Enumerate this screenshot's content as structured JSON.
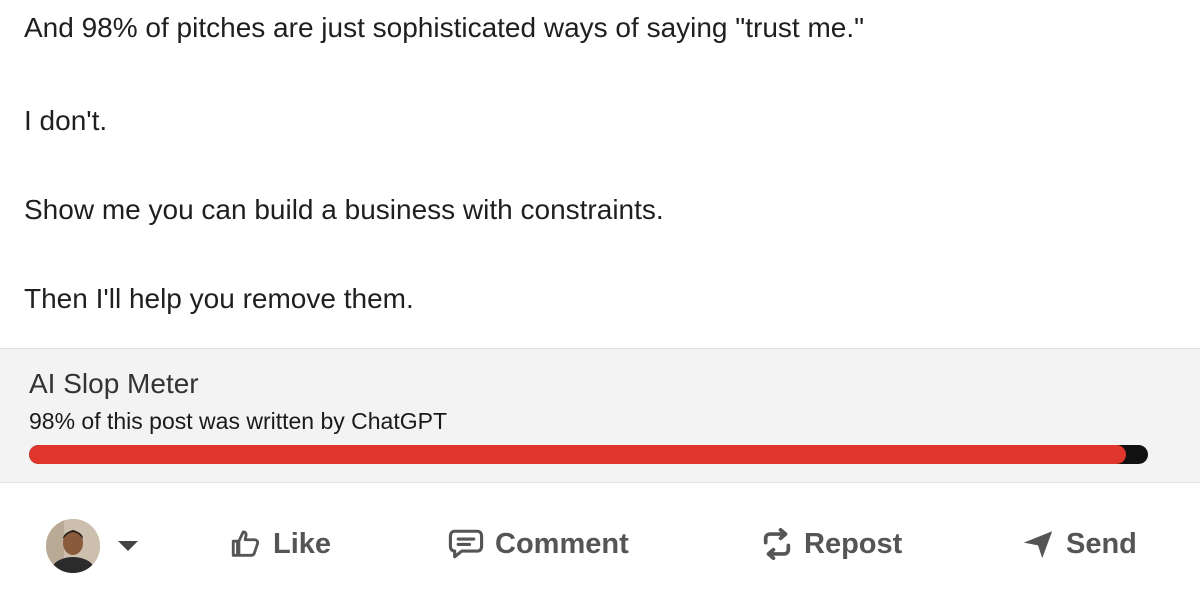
{
  "post": {
    "paragraphs": [
      "And 98% of pitches are just sophisticated ways of saying \"trust me.\"",
      "I don't.",
      "Show me you can build a business with constraints.",
      "Then I'll help you remove them."
    ]
  },
  "slop_meter": {
    "title": "AI Slop Meter",
    "subtitle": "98% of this post was written by ChatGPT",
    "percent": 98,
    "fill_color": "#e0362b",
    "track_color": "#111111"
  },
  "actions": {
    "like": {
      "label": "Like",
      "icon": "thumbs-up-icon"
    },
    "comment": {
      "label": "Comment",
      "icon": "comment-icon"
    },
    "repost": {
      "label": "Repost",
      "icon": "repost-icon"
    },
    "send": {
      "label": "Send",
      "icon": "send-icon"
    }
  },
  "avatar": {
    "icon": "user-avatar",
    "dropdown_icon": "caret-down-icon"
  }
}
